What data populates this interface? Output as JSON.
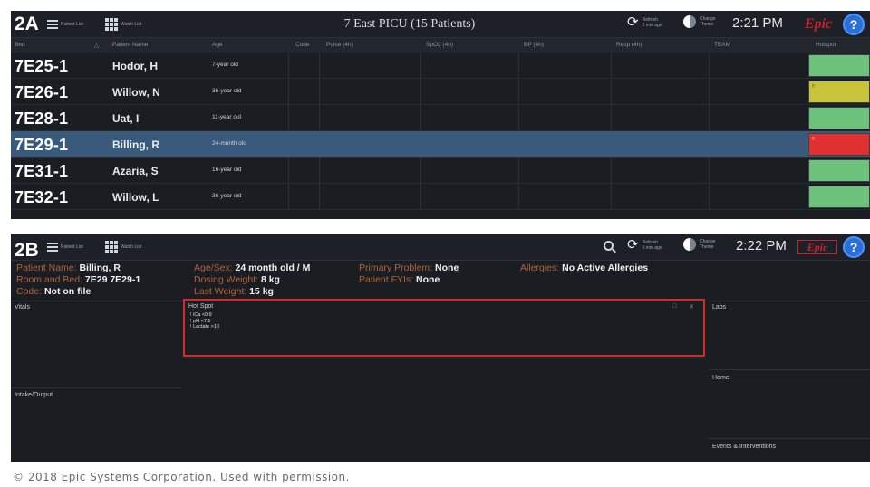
{
  "panelA": {
    "label": "2A",
    "toolbar": {
      "patient_list": "Patient List",
      "watch_list": "Watch List"
    },
    "unit_title": "7 East PICU (15 Patients)",
    "refresh": {
      "label": "Refresh",
      "sub": "5 min ago"
    },
    "theme": {
      "label": "Change",
      "sub": "Theme"
    },
    "time": "2:21 PM",
    "logo": "Epic",
    "columns": {
      "bed": "Bed",
      "patient_name": "Patient Name",
      "age": "Age",
      "code": "Code",
      "pulse": "Pulse (4h)",
      "spo2": "SpO2 (4h)",
      "bp": "BP (4h)",
      "resp": "Resp (4h)",
      "team": "TEAM",
      "hotspot": "Hotspot"
    },
    "patients": [
      {
        "bed": "7E25-1",
        "name": "Hodor, H",
        "age": "7-year old",
        "hotspot_color": "#6cc27a",
        "hotspot_flag": ""
      },
      {
        "bed": "7E26-1",
        "name": "Willow, N",
        "age": "36-year old",
        "hotspot_color": "#c7c43c",
        "hotspot_flag": "!!"
      },
      {
        "bed": "7E28-1",
        "name": "Uat, I",
        "age": "11-year old",
        "hotspot_color": "#6cc27a",
        "hotspot_flag": ""
      },
      {
        "bed": "7E29-1",
        "name": "Billing, R",
        "age": "24-month old",
        "hotspot_color": "#e0302f",
        "hotspot_flag": "!!"
      },
      {
        "bed": "7E31-1",
        "name": "Azaria, S",
        "age": "16-year old",
        "hotspot_color": "#6cc27a",
        "hotspot_flag": ""
      },
      {
        "bed": "7E32-1",
        "name": "Willow, L",
        "age": "36-year old",
        "hotspot_color": "#6cc27a",
        "hotspot_flag": ""
      }
    ],
    "selected_index": 3
  },
  "panelB": {
    "label": "2B",
    "toolbar": {
      "patient_list": "Patient List",
      "watch_list": "Watch List"
    },
    "refresh": {
      "label": "Refresh",
      "sub": "5 min ago"
    },
    "theme": {
      "label": "Change",
      "sub": "Theme"
    },
    "time": "2:22 PM",
    "logo": "Epic",
    "info": {
      "patient_name_label": "Patient Name:",
      "patient_name": "Billing, R",
      "room_label": "Room and Bed:",
      "room": "7E29 7E29-1",
      "code_label": "Code:",
      "code": "Not on file",
      "agesex_label": "Age/Sex:",
      "agesex": "24 month old / M",
      "dosing_label": "Dosing Weight:",
      "dosing": "8 kg",
      "last_weight_label": "Last Weight:",
      "last_weight": "15 kg",
      "problem_label": "Primary Problem:",
      "problem": "None",
      "fyi_label": "Patient FYIs:",
      "fyi": "None",
      "allergies_label": "Allergies:",
      "allergies": "No Active Allergies"
    },
    "sections": {
      "vitals": "Vitals",
      "hotspot": "Hot Spot",
      "labs": "Labs",
      "intake_output": "Intake/Output",
      "home": "Home",
      "events": "Events & Interventions"
    },
    "hotspot_items": [
      "iCa <0.9",
      "pH <7.1",
      "Lactate >10"
    ]
  },
  "copyright": "© 2018 Epic Systems Corporation. Used with permission."
}
